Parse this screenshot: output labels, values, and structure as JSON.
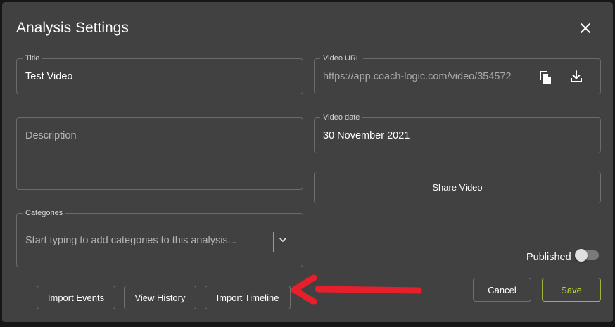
{
  "dialog": {
    "title": "Analysis Settings"
  },
  "title_field": {
    "label": "Title",
    "value": "Test Video"
  },
  "description_field": {
    "placeholder": "Description"
  },
  "categories_field": {
    "label": "Categories",
    "placeholder": "Start typing to add categories to this analysis..."
  },
  "video_url_field": {
    "label": "Video URL",
    "value": "https://app.coach-logic.com/video/354572"
  },
  "video_date_field": {
    "label": "Video date",
    "value": "30 November 2021"
  },
  "buttons": {
    "share_video": "Share Video",
    "import_events": "Import Events",
    "view_history": "View History",
    "import_timeline": "Import Timeline",
    "cancel": "Cancel",
    "save": "Save"
  },
  "published": {
    "label": "Published",
    "enabled": false
  },
  "colors": {
    "dialog_bg": "#414141",
    "save_accent": "#c6df3a",
    "annotation_arrow": "#e5202a"
  },
  "icons": {
    "close": "close-icon",
    "copy": "copy-icon",
    "download": "download-icon",
    "dropdown": "chevron-down-icon"
  }
}
